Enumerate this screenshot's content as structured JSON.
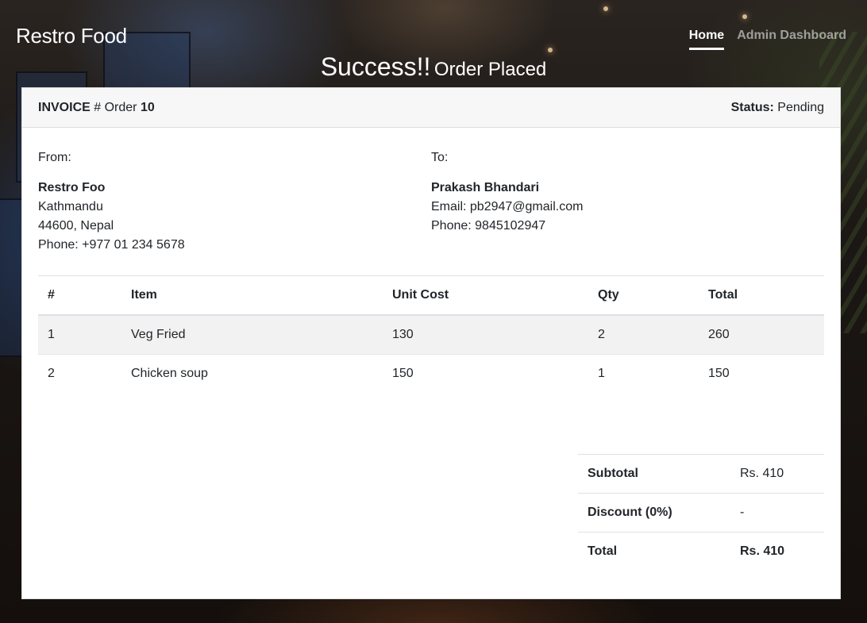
{
  "navbar": {
    "brand": "Restro Food",
    "links": [
      {
        "label": "Home",
        "active": true
      },
      {
        "label": "Admin Dashboard",
        "active": false
      }
    ]
  },
  "headline": {
    "strong": "Success!!",
    "rest": "Order Placed"
  },
  "invoice": {
    "label": "INVOICE",
    "hash": "#",
    "order_word": "Order",
    "order_number": "10",
    "status_label": "Status:",
    "status_value": "Pending"
  },
  "from": {
    "label": "From:",
    "name": "Restro Foo",
    "lines": [
      "Kathmandu",
      "44600, Nepal",
      "Phone: +977 01 234 5678"
    ]
  },
  "to": {
    "label": "To:",
    "name": "Prakash Bhandari",
    "lines": [
      "Email: pb2947@gmail.com",
      "Phone: 9845102947"
    ]
  },
  "items_table": {
    "headers": [
      "#",
      "Item",
      "Unit Cost",
      "Qty",
      "Total"
    ],
    "rows": [
      [
        "1",
        "Veg Fried",
        "130",
        "2",
        "260"
      ],
      [
        "2",
        "Chicken soup",
        "150",
        "1",
        "150"
      ]
    ]
  },
  "totals": {
    "subtotal_label": "Subtotal",
    "subtotal_value": "Rs. 410",
    "discount_label": "Discount (0%)",
    "discount_value": "-",
    "total_label": "Total",
    "total_value": "Rs. 410"
  }
}
